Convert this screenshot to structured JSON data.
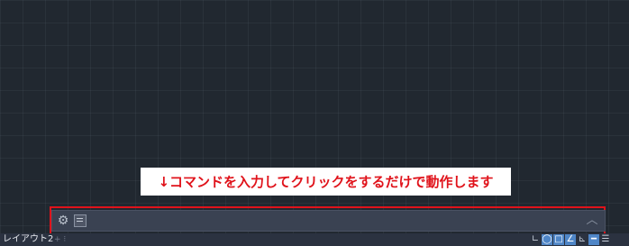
{
  "callout": {
    "text": "↓コマンドを入力してクリックをするだけで動作します"
  },
  "command_line": {
    "input_value": "",
    "settings_icon": "gear-icon",
    "history_icon": "command-history-icon",
    "expand_icon": "chevron-up-icon"
  },
  "status_bar": {
    "layout_tab": "レイアウト2",
    "tab_controls": "+ ⁝",
    "icons": [
      {
        "name": "ortho-icon",
        "glyph": "∟",
        "active": false
      },
      {
        "name": "polar-tracking-icon",
        "glyph": "◯",
        "active": true
      },
      {
        "name": "object-snap-icon",
        "glyph": "□",
        "active": true
      },
      {
        "name": "object-snap-tracking-icon",
        "glyph": "∠",
        "active": true
      },
      {
        "name": "dynamic-ucs-icon",
        "glyph": "⊾",
        "active": false
      },
      {
        "name": "lineweight-icon",
        "glyph": "━",
        "active": true
      },
      {
        "name": "customization-menu-icon",
        "glyph": "☰",
        "active": false
      }
    ]
  },
  "colors": {
    "annotation_red": "#e0131b",
    "canvas_background": "#212830",
    "command_bar": "#3a4252",
    "active_toggle": "#4f86c7"
  }
}
